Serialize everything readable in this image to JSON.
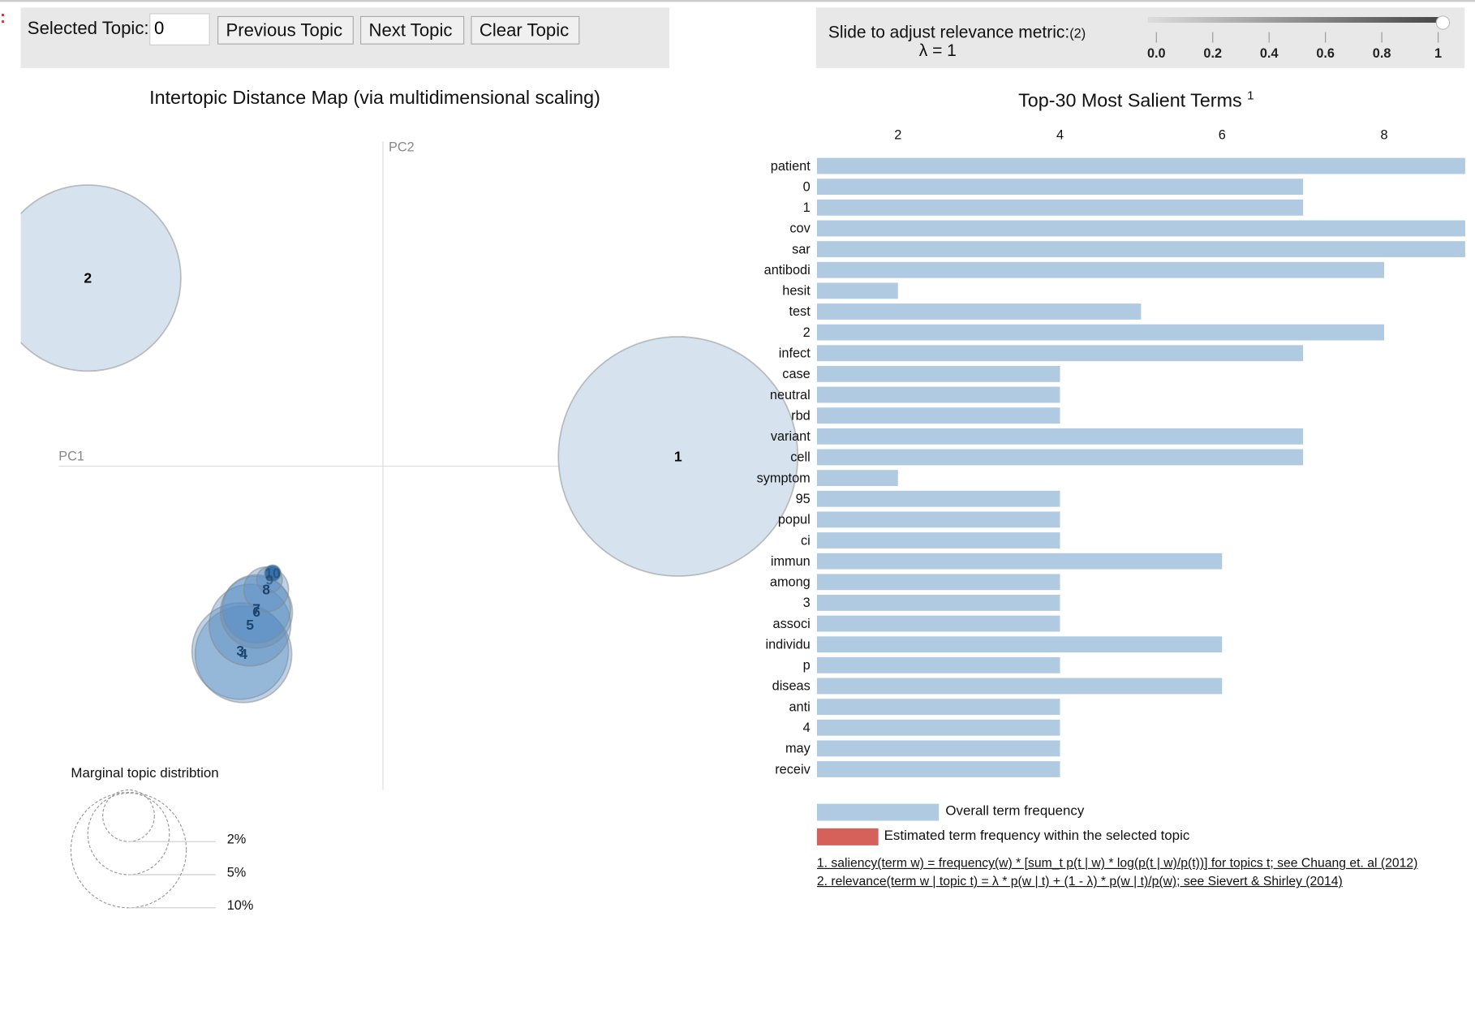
{
  "controls": {
    "marker": ":",
    "selected_topic_label": "Selected Topic:",
    "selected_topic_value": "0",
    "previous_label": "Previous Topic",
    "next_label": "Next Topic",
    "clear_label": "Clear Topic",
    "slider_label": "Slide to adjust relevance metric:",
    "slider_footnote": "(2)",
    "lambda_text": "λ = 1",
    "lambda_value": 1,
    "slider_ticks": [
      "0.0",
      "0.2",
      "0.4",
      "0.6",
      "0.8",
      "1"
    ]
  },
  "chart_data": [
    {
      "type": "scatter",
      "title": "Intertopic Distance Map (via multidimensional scaling)",
      "xlabel": "PC1",
      "ylabel": "PC2",
      "topics": [
        {
          "id": "1",
          "pc1": 0.91,
          "pc2": 0.03,
          "marginal_pct": 43
        },
        {
          "id": "2",
          "pc1": -0.91,
          "pc2": 0.58,
          "marginal_pct": 26
        },
        {
          "id": "3",
          "pc1": -0.44,
          "pc2": -0.57,
          "marginal_pct": 7
        },
        {
          "id": "4",
          "pc1": -0.43,
          "pc2": -0.58,
          "marginal_pct": 7
        },
        {
          "id": "5",
          "pc1": -0.41,
          "pc2": -0.49,
          "marginal_pct": 5
        },
        {
          "id": "6",
          "pc1": -0.39,
          "pc2": -0.45,
          "marginal_pct": 3.9
        },
        {
          "id": "7",
          "pc1": -0.39,
          "pc2": -0.44,
          "marginal_pct": 3.5
        },
        {
          "id": "8",
          "pc1": -0.36,
          "pc2": -0.38,
          "marginal_pct": 1.5
        },
        {
          "id": "9",
          "pc1": -0.35,
          "pc2": -0.35,
          "marginal_pct": 0.5
        },
        {
          "id": "10",
          "pc1": -0.34,
          "pc2": -0.33,
          "marginal_pct": 0.2
        }
      ],
      "colors": {
        "fill": "#1f77b4",
        "stroke": "#888888"
      },
      "legend": {
        "title": "Marginal topic distribtion",
        "entries": [
          {
            "label": "2%",
            "pct": 2
          },
          {
            "label": "5%",
            "pct": 5
          },
          {
            "label": "10%",
            "pct": 10
          }
        ],
        "placement": "bottom-left"
      }
    },
    {
      "type": "bar",
      "orientation": "horizontal",
      "title": "Top-30 Most Salient Terms",
      "title_footnote": "1",
      "xlim": [
        1,
        9
      ],
      "xticks": [
        "2",
        "4",
        "6",
        "8"
      ],
      "categories": [
        "patient",
        "0",
        "1",
        "cov",
        "sar",
        "antibodi",
        "hesit",
        "test",
        "2",
        "infect",
        "case",
        "neutral",
        "rbd",
        "variant",
        "cell",
        "symptom",
        "95",
        "popul",
        "ci",
        "immun",
        "among",
        "3",
        "associ",
        "individu",
        "p",
        "diseas",
        "anti",
        "4",
        "may",
        "receiv"
      ],
      "series": [
        {
          "name": "Overall term frequency",
          "color": "#b0cbe1",
          "values": [
            9,
            7,
            7,
            9,
            9,
            8,
            2,
            5,
            8,
            7,
            4,
            4,
            4,
            7,
            7,
            2,
            4,
            4,
            4,
            6,
            4,
            4,
            4,
            6,
            4,
            6,
            4,
            4,
            4,
            4
          ]
        }
      ],
      "legend": [
        {
          "label": "Overall term frequency",
          "color": "#b0cbe1"
        },
        {
          "label": "Estimated term frequency within the selected topic",
          "color": "#d6605a"
        }
      ]
    }
  ],
  "footnotes": [
    "1. saliency(term w) = frequency(w) * [sum_t p(t | w) * log(p(t | w)/p(t))] for topics t; see Chuang et. al (2012)",
    "2. relevance(term w | topic t) = λ * p(w | t) + (1 - λ) * p(w | t)/p(w); see Sievert & Shirley (2014)"
  ]
}
